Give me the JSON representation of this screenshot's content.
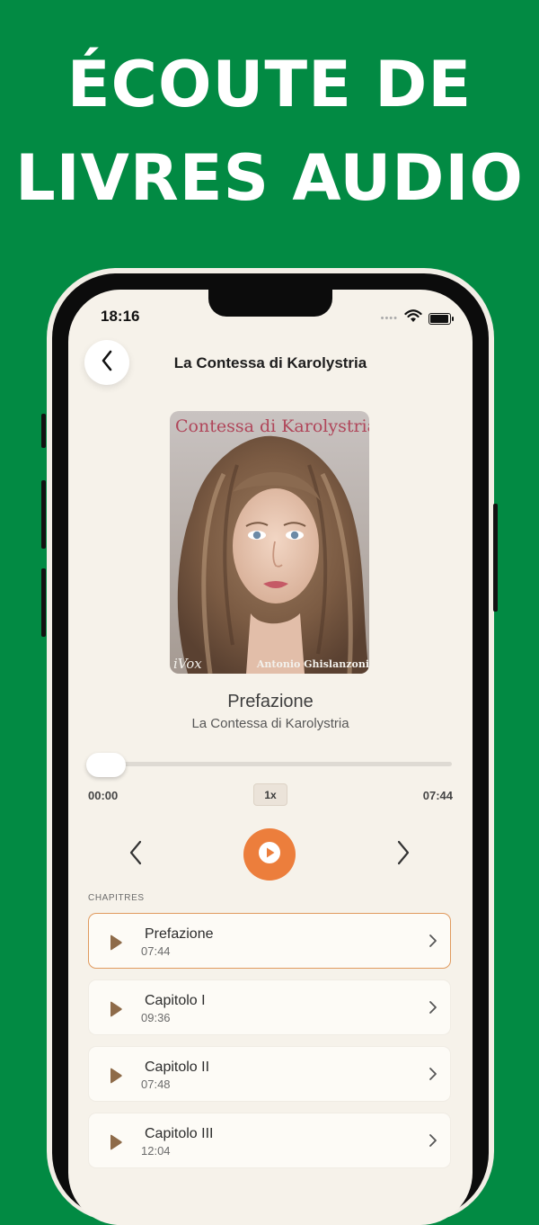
{
  "headline": {
    "line1": "ÉCOUTE DE",
    "line2": "LIVRES AUDIO"
  },
  "status_bar": {
    "time": "18:16",
    "dots": "••••"
  },
  "nav": {
    "title": "La Contessa di Karolystria"
  },
  "cover": {
    "title": "Contessa di Karolystria",
    "brand": "iVox",
    "author": "Antonio Ghislanzoni"
  },
  "now_playing": {
    "title": "Prefazione",
    "subtitle": "La Contessa di Karolystria"
  },
  "player": {
    "current_time": "00:00",
    "total_time": "07:44",
    "speed": "1x",
    "progress": 0
  },
  "section_label": "CHAPITRES",
  "chapters": [
    {
      "name": "Prefazione",
      "duration": "07:44"
    },
    {
      "name": "Capitolo I",
      "duration": "09:36"
    },
    {
      "name": "Capitolo II",
      "duration": "07:48"
    },
    {
      "name": "Capitolo III",
      "duration": "12:04"
    }
  ],
  "colors": {
    "background": "#028a43",
    "accent": "#ec7e3c",
    "chapter_play_icon": "#8e6b49"
  }
}
